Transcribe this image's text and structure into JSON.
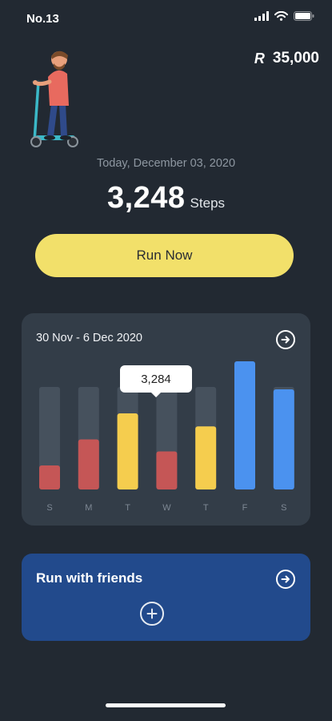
{
  "status_bar": {
    "carrier": "No.13",
    "icons": [
      "signal-icon",
      "wifi-icon",
      "battery-icon"
    ]
  },
  "balance": {
    "currency_symbol": "R",
    "amount": "35,000"
  },
  "avatar": {
    "icon": "scooter-rider-illustration"
  },
  "summary": {
    "date": "Today, December 03, 2020",
    "steps_value": "3,248",
    "steps_unit": "Steps"
  },
  "run_button": {
    "label": "Run Now"
  },
  "weekly_chart": {
    "range_label": "30 Nov -  6 Dec 2020",
    "arrow_icon": "arrow-right-circle-icon",
    "tooltip_value": "3,284"
  },
  "chart_data": {
    "type": "bar",
    "categories": [
      "S",
      "M",
      "T",
      "W",
      "T",
      "F",
      "S"
    ],
    "values": [
      24,
      50,
      76,
      38,
      63,
      128,
      100
    ],
    "max": 128,
    "highlight_index": 3,
    "bar_colors": [
      "#c55656",
      "#c55656",
      "#f5cd4e",
      "#c55656",
      "#f5cd4e",
      "#4b92ef",
      "#4b92ef"
    ],
    "track_color": "#46515d",
    "tick_color": "#7e8894"
  },
  "friends_card": {
    "title": "Run with friends",
    "arrow_icon": "arrow-right-circle-icon",
    "add_icon": "plus-circle-icon"
  },
  "colors": {
    "background": "#222932",
    "accent_yellow": "#f2e06a",
    "card": "#333d48",
    "friends_blue": "#224a8c"
  }
}
